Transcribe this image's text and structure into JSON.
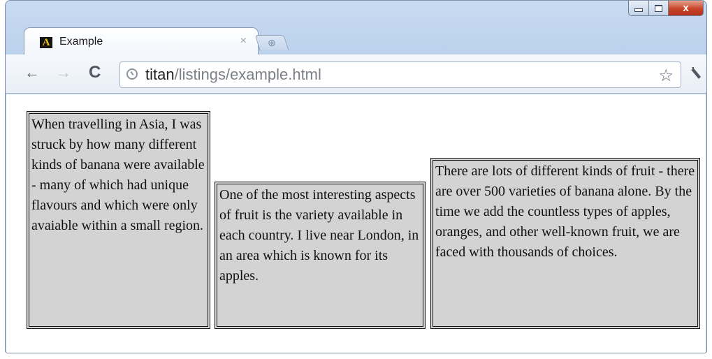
{
  "browser": {
    "tab": {
      "title": "Example",
      "favicon_letter": "A",
      "close_glyph": "×"
    },
    "new_tab_glyph": "⊕",
    "controls": {
      "minimize_icon": "minimize-icon",
      "maximize_icon": "maximize-icon",
      "close_glyph": "x"
    },
    "toolbar": {
      "back_glyph": "←",
      "forward_glyph": "→",
      "reload_glyph": "C",
      "url_host": "titan",
      "url_path": "/listings/example.html",
      "star_glyph": "☆"
    }
  },
  "page": {
    "paragraphs": [
      "When travelling in Asia, I was struck by how many different kinds of banana were available - many of which had unique flavours and which were only avaiable within a small region.",
      "One of the most interesting aspects of fruit is the variety available in each country. I live near London, in an area which is known for its apples.",
      "There are lots of different kinds of fruit - there are over 500 varieties of banana alone. By the time we add the countless types of apples, oranges, and other well-known fruit, we are faced with thousands of choices."
    ],
    "box_background": "#d3d3d3",
    "box_border": "#151515"
  }
}
